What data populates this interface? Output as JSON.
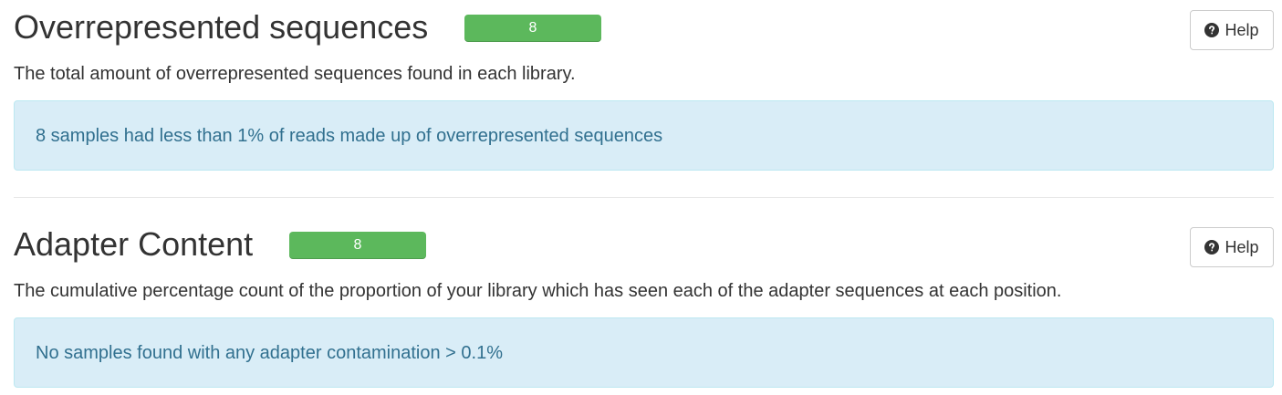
{
  "sections": [
    {
      "title": "Overrepresented sequences",
      "status_count": "8",
      "status_color": "#5cb85c",
      "help_label": "Help",
      "help_icon": "question-circle-icon",
      "description": "The total amount of overrepresented sequences found in each library.",
      "alert": "8 samples had less than 1% of reads made up of overrepresented sequences"
    },
    {
      "title": "Adapter Content",
      "status_count": "8",
      "status_color": "#5cb85c",
      "help_label": "Help",
      "help_icon": "question-circle-icon",
      "description": "The cumulative percentage count of the proportion of your library which has seen each of the adapter sequences at each position.",
      "alert": "No samples found with any adapter contamination > 0.1%"
    }
  ],
  "colors": {
    "alert_background": "#d9edf7",
    "alert_text": "#31708f",
    "success": "#5cb85c"
  }
}
